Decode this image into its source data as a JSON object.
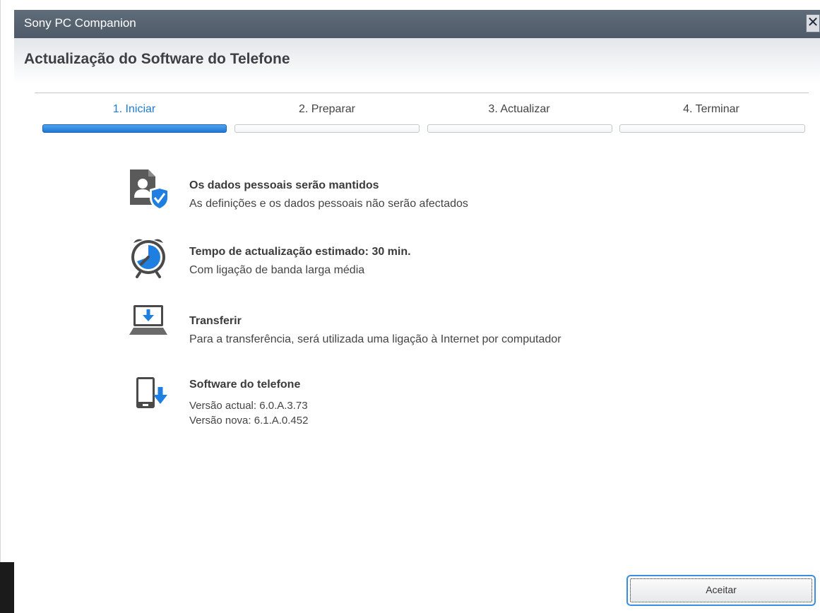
{
  "window": {
    "title": "Sony PC Companion",
    "close_glyph": "✕"
  },
  "header": {
    "title": "Actualização do Software do Telefone"
  },
  "steps": [
    {
      "label": "1. Iniciar",
      "active": true
    },
    {
      "label": "2. Preparar",
      "active": false
    },
    {
      "label": "3. Actualizar",
      "active": false
    },
    {
      "label": "4. Terminar",
      "active": false
    }
  ],
  "items": [
    {
      "icon": "personal-data-shield-icon",
      "heading": "Os dados pessoais serão mantidos",
      "lines": [
        "As definições e os dados pessoais não serão afectados"
      ]
    },
    {
      "icon": "alarm-clock-icon",
      "heading": "Tempo de actualização estimado: 30 min.",
      "lines": [
        "Com ligação de banda larga média"
      ]
    },
    {
      "icon": "laptop-download-icon",
      "heading": "Transferir",
      "lines": [
        "Para a transferência, será utilizada uma ligação à Internet por computador"
      ]
    },
    {
      "icon": "phone-download-icon",
      "heading": "Software do telefone",
      "lines": [
        "Versão actual: 6.0.A.3.73",
        "Versão nova: 6.1.A.0.452"
      ]
    }
  ],
  "footer": {
    "accept_label": "Aceitar"
  },
  "colors": {
    "accent": "#1d7cd9",
    "titlebar": "#56626f",
    "icon_gray": "#5a5a5a",
    "icon_blue": "#1e7fe0"
  }
}
